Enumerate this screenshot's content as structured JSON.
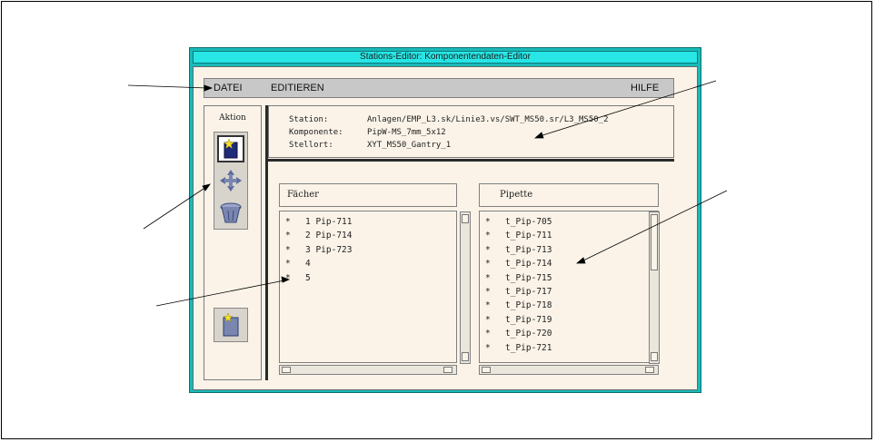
{
  "window": {
    "title": "Stations-Editor: Komponentendaten-Editor"
  },
  "menubar": {
    "datei": "DATEI",
    "editieren": "EDITIEREN",
    "hilfe": "HILFE"
  },
  "aktion": {
    "label": "Aktion",
    "tools": [
      {
        "icon": "new-document-star-icon",
        "active": true
      },
      {
        "icon": "move-arrows-icon",
        "active": false
      },
      {
        "icon": "trash-bin-icon",
        "active": false
      }
    ],
    "extra_tool_icon": "document-star-icon"
  },
  "info": {
    "station_key": "Station:",
    "station_value": "Anlagen/EMP_L3.sk/Linie3.vs/SWT_MS50.sr/L3_MS50_2",
    "komponente_key": "Komponente:",
    "komponente_value": "PipW-MS_7mm_5x12",
    "stellort_key": "Stellort:",
    "stellort_value": "XYT_MS50_Gantry_1"
  },
  "faecher": {
    "header": "Fächer",
    "items": [
      {
        "bullet": "*",
        "text": "1 Pip-711"
      },
      {
        "bullet": "*",
        "text": "2 Pip-714"
      },
      {
        "bullet": "*",
        "text": "3 Pip-723"
      },
      {
        "bullet": "*",
        "text": "4"
      },
      {
        "bullet": "*",
        "text": "5"
      }
    ]
  },
  "pipette": {
    "header": "Pipette",
    "items": [
      {
        "bullet": "*",
        "text": "t_Pip-705"
      },
      {
        "bullet": "*",
        "text": "t_Pip-711"
      },
      {
        "bullet": "*",
        "text": "t_Pip-713"
      },
      {
        "bullet": "*",
        "text": "t_Pip-714"
      },
      {
        "bullet": "*",
        "text": "t_Pip-715"
      },
      {
        "bullet": "*",
        "text": "t_Pip-717"
      },
      {
        "bullet": "*",
        "text": "t_Pip-718"
      },
      {
        "bullet": "*",
        "text": "t_Pip-719"
      },
      {
        "bullet": "*",
        "text": "t_Pip-720"
      },
      {
        "bullet": "*",
        "text": "t_Pip-721"
      }
    ]
  },
  "colors": {
    "window_frame": "#1ab9b9",
    "titlebar": "#29e6e6",
    "client_bg": "#fbf3e8",
    "menubar_bg": "#c8c8c8"
  }
}
